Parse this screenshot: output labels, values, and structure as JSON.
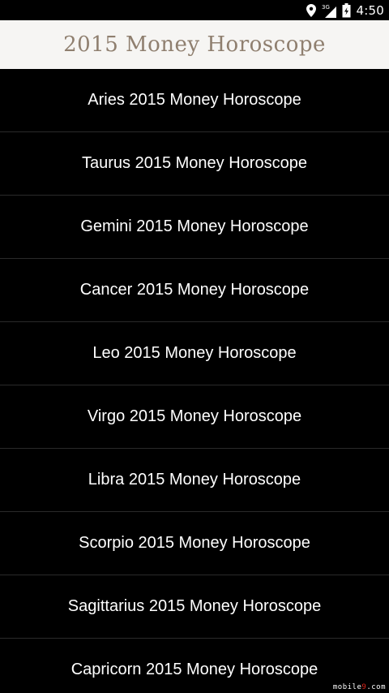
{
  "status_bar": {
    "network_label": "3G",
    "time": "4:50"
  },
  "header": {
    "title": "2015 Money Horoscope"
  },
  "list": {
    "items": [
      {
        "label": "Aries 2015 Money Horoscope"
      },
      {
        "label": "Taurus 2015 Money Horoscope"
      },
      {
        "label": "Gemini 2015 Money Horoscope"
      },
      {
        "label": "Cancer 2015 Money Horoscope"
      },
      {
        "label": "Leo 2015 Money Horoscope"
      },
      {
        "label": "Virgo 2015 Money Horoscope"
      },
      {
        "label": "Libra 2015 Money Horoscope"
      },
      {
        "label": "Scorpio 2015 Money Horoscope"
      },
      {
        "label": "Sagittarius 2015 Money Horoscope"
      },
      {
        "label": "Capricorn 2015 Money Horoscope"
      }
    ]
  },
  "watermark": {
    "text_a": "mobile",
    "text_b": "9",
    "text_c": ".com"
  },
  "colors": {
    "background": "#000000",
    "title_bar": "#f6f5f3",
    "title_text": "#8f7f6f",
    "item_text": "#ffffff",
    "divider": "#2a2a2a"
  },
  "icons": [
    "location-icon",
    "signal-icon",
    "battery-icon"
  ]
}
